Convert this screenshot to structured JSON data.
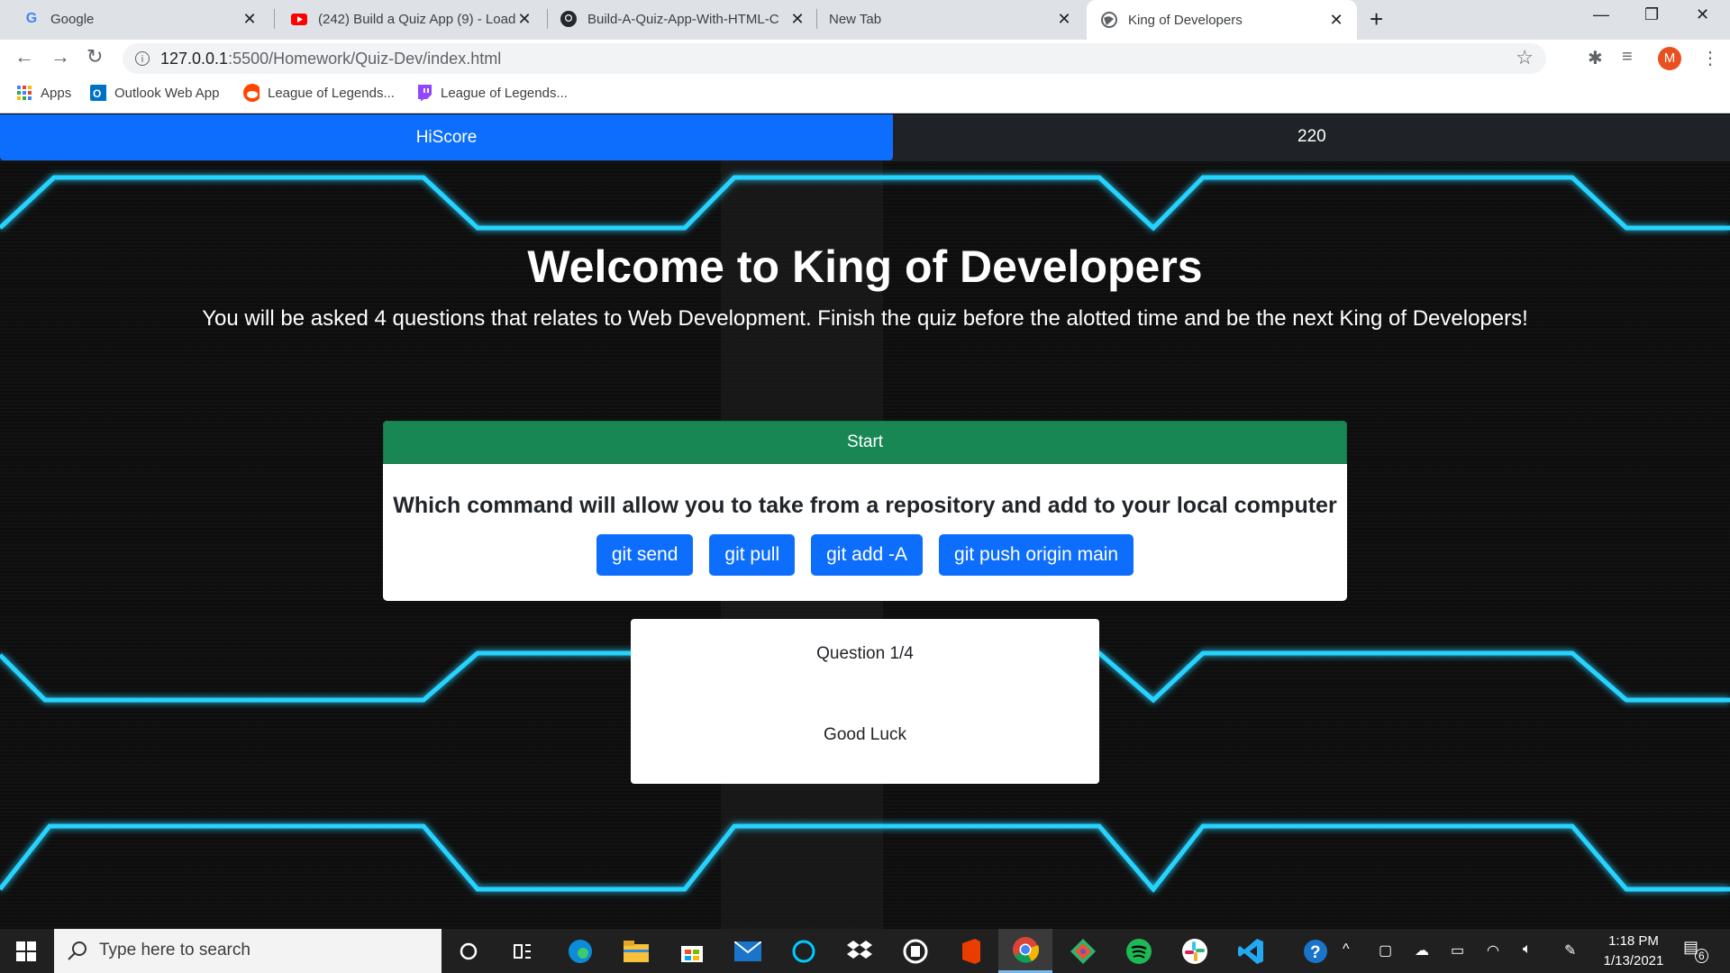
{
  "browser": {
    "tabs": [
      {
        "title": "Google",
        "favicon": "google-icon"
      },
      {
        "title": "(242) Build a Quiz App (9) - Load",
        "favicon": "youtube-icon"
      },
      {
        "title": "Build-A-Quiz-App-With-HTML-C",
        "favicon": "github-icon"
      },
      {
        "title": "New Tab",
        "favicon": ""
      },
      {
        "title": "King of Developers",
        "favicon": "globe-icon",
        "active": true
      }
    ],
    "new_tab": "+",
    "url_host": "127.0.0.1",
    "url_rest": ":5500/Homework/Quiz-Dev/index.html",
    "profile_initial": "M",
    "bookmarks": [
      {
        "label": "Apps",
        "icon": "apps-grid-icon"
      },
      {
        "label": "Outlook Web App",
        "icon": "outlook-icon"
      },
      {
        "label": "League of Legends...",
        "icon": "reddit-icon"
      },
      {
        "label": "League of Legends...",
        "icon": "twitch-icon"
      }
    ]
  },
  "page": {
    "hiscore_label": "HiScore",
    "timer": "220",
    "heading": "Welcome to King of Developers",
    "subtitle": "You will be asked 4 questions that relates to Web Development. Finish the quiz before the alotted time and be the next King of Developers!",
    "start_label": "Start",
    "question": "Which command will allow you to take from a repository and add to your local computer",
    "answers": [
      "git send",
      "git pull",
      "git add -A",
      "git push origin main"
    ],
    "question_counter": "Question 1/4",
    "good_luck": "Good Luck",
    "accent_colors": {
      "primary": "#0d6efd",
      "success": "#198754",
      "neon": "#27d3ff"
    }
  },
  "taskbar": {
    "search_placeholder": "Type here to search",
    "time": "1:18 PM",
    "date": "1/13/2021",
    "notification_count": "6"
  }
}
